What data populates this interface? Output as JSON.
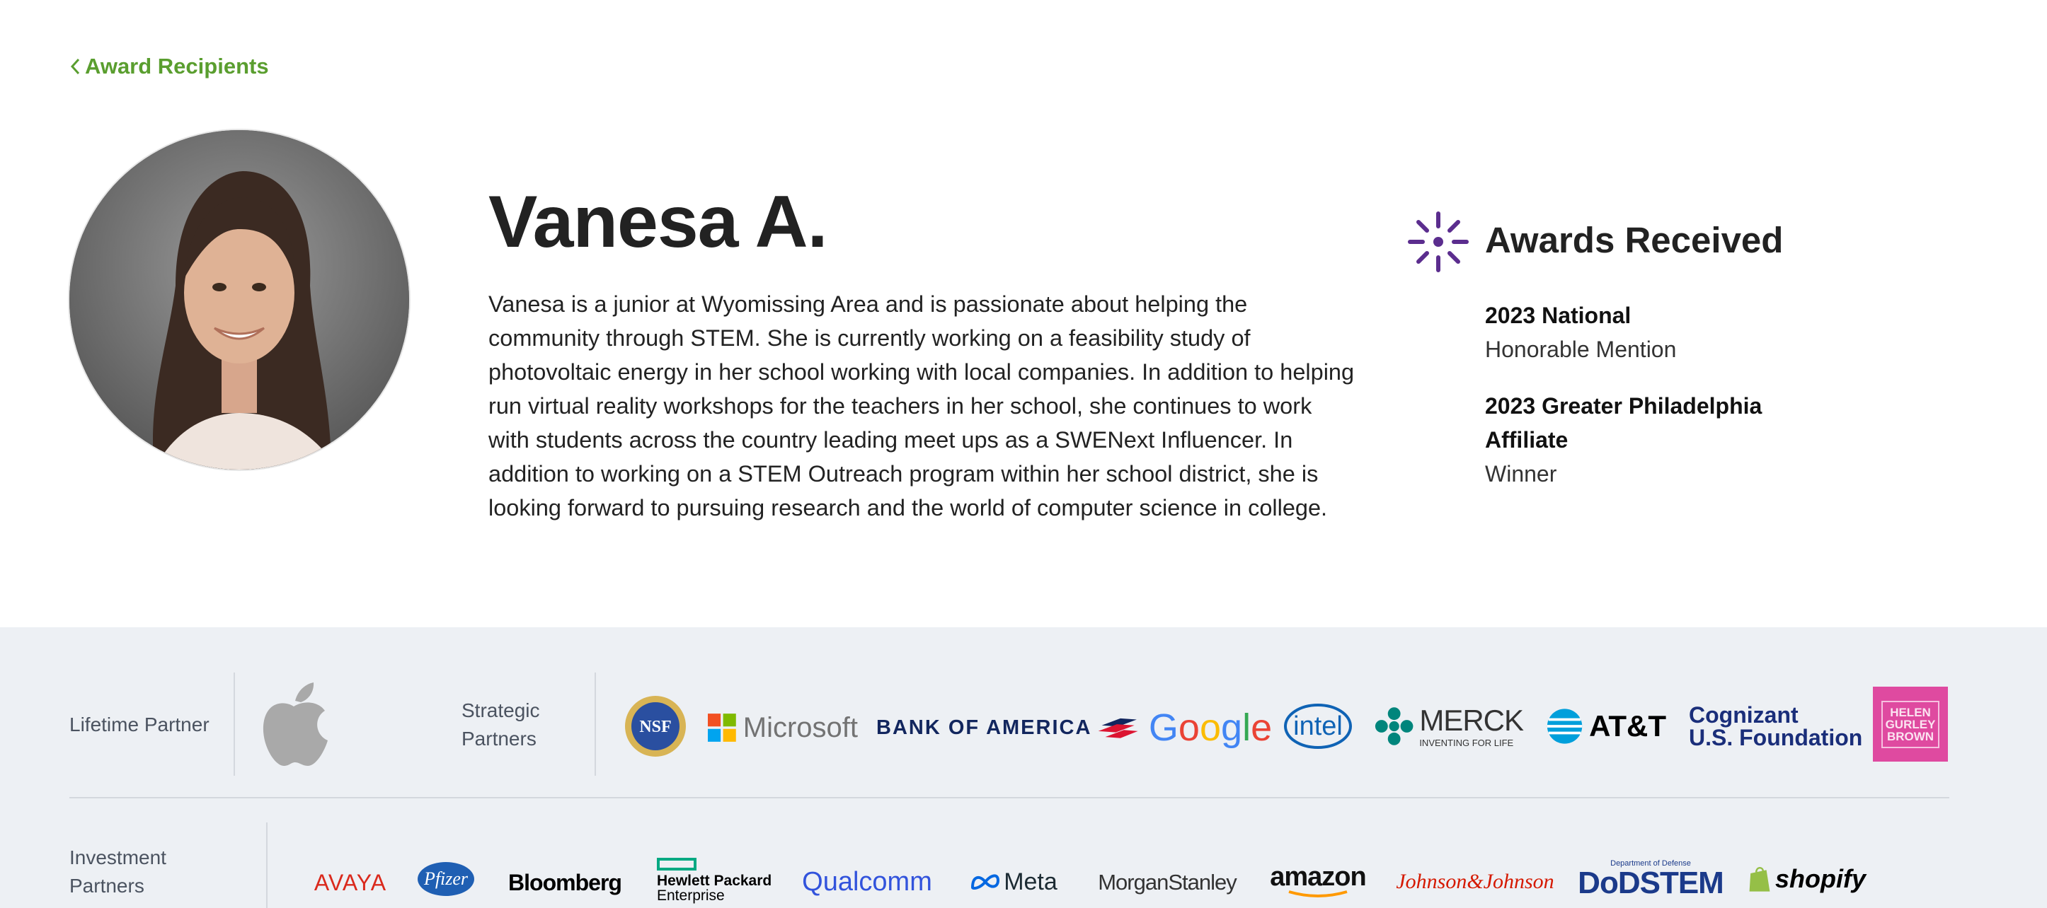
{
  "nav": {
    "back_label": "Award Recipients"
  },
  "profile": {
    "name": "Vanesa A.",
    "bio": "Vanesa is a junior at Wyomissing Area and is passionate about helping the community through STEM. She is currently working on a feasibility study of photovoltaic energy in her school working with local companies. In addition to helping run virtual reality workshops for the teachers in her school, she continues to work with students across the country leading meet ups as a SWENext Influencer. In addition to working on a STEM Outreach program within her school district, she is looking forward to pursuing research and the world of computer science in college."
  },
  "awards": {
    "title": "Awards Received",
    "items": [
      {
        "year": "2023 National",
        "result": "Honorable Mention"
      },
      {
        "year": "2023 Greater Philadelphia Affiliate",
        "result": "Winner"
      }
    ]
  },
  "partners": {
    "lifetime_label": "Lifetime Partner",
    "strategic_label": "Strategic Partners",
    "investment_label": "Investment Partners",
    "lifetime_logos": [
      "apple-logo"
    ],
    "strategic_logos": [
      {
        "icon": "nsf-logo"
      },
      {
        "name": "Microsoft"
      },
      {
        "name": "BANK OF AMERICA"
      },
      {
        "name": "Google"
      },
      {
        "name": "intel"
      },
      {
        "name": "MERCK",
        "tagline": "INVENTING FOR LIFE"
      },
      {
        "name": "AT&T"
      },
      {
        "name": "Cognizant",
        "line2": "U.S. Foundation"
      },
      {
        "lines": [
          "HELEN",
          "GURLEY",
          "BROWN"
        ]
      }
    ],
    "investment_logos": [
      {
        "name": "AVAYA"
      },
      {
        "name": "Pfizer"
      },
      {
        "name": "Bloomberg"
      },
      {
        "name": "Hewlett Packard",
        "line2": "Enterprise"
      },
      {
        "name": "Qualcomm"
      },
      {
        "name": "Meta"
      },
      {
        "name": "MorganStanley"
      },
      {
        "name": "amazon"
      },
      {
        "name": "Johnson&Johnson"
      },
      {
        "name": "DoDSTEM",
        "tagline": "Department of Defense"
      },
      {
        "name": "shopify"
      }
    ]
  },
  "colors": {
    "accent_green": "#5a9e2f",
    "awards_purple": "#5b2d8e",
    "partners_bg": "#edf0f4"
  }
}
